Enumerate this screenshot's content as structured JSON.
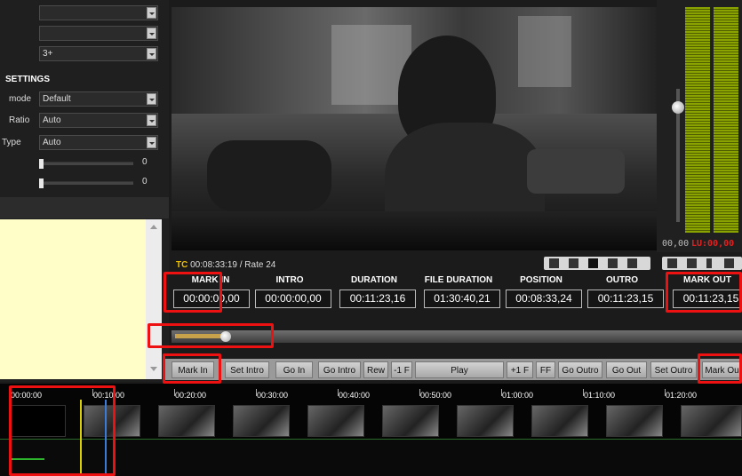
{
  "settings": {
    "select_top_1": "",
    "select_top_2": "",
    "select_top_3": "3+",
    "section_title": "SETTINGS",
    "rows": [
      {
        "label": "mode",
        "value": "Default"
      },
      {
        "label": "Ratio",
        "value": "Auto"
      },
      {
        "label": "Type",
        "value": "Auto"
      }
    ],
    "slider_1_value": "0",
    "slider_2_value": "0"
  },
  "player": {
    "timecode_tag": "TC",
    "timecode_info": "00:08:33:19 / Rate 24"
  },
  "meter": {
    "readout_left": "00,00",
    "readout_right": "LU:00,00"
  },
  "fields": [
    {
      "label": "MARK IN",
      "value": "00:00:00,00"
    },
    {
      "label": "INTRO",
      "value": "00:00:00,00"
    },
    {
      "label": "DURATION",
      "value": "00:11:23,16"
    },
    {
      "label": "FILE DURATION",
      "value": "01:30:40,21"
    },
    {
      "label": "POSITION",
      "value": "00:08:33,24"
    },
    {
      "label": "OUTRO",
      "value": "00:11:23,15"
    },
    {
      "label": "MARK OUT",
      "value": "00:11:23,15"
    }
  ],
  "progress": {
    "position_fraction": 0.094
  },
  "buttons": {
    "mark_in": "Mark In",
    "set_intro": "Set Intro",
    "go_in": "Go In",
    "go_intro": "Go Intro",
    "rew": "Rew",
    "minus_1f": "-1 F",
    "play": "Play",
    "plus_1f": "+1 F",
    "ff": "FF",
    "go_outro": "Go Outro",
    "go_out": "Go Out",
    "set_outro": "Set Outro",
    "mark_out": "Mark Ou"
  },
  "timeline": {
    "ticks": [
      "00:00:00",
      "00:10:00",
      "00:20:00",
      "00:30:00",
      "00:40:00",
      "00:50:00",
      "01:00:00",
      "01:10:00",
      "01:20:00"
    ]
  },
  "colors": {
    "highlight": "#e11111",
    "timecode_tag": "#f0c000",
    "meter_green": "#8aa300",
    "meter_red": "#e02020",
    "notes_bg": "#fffec8"
  }
}
